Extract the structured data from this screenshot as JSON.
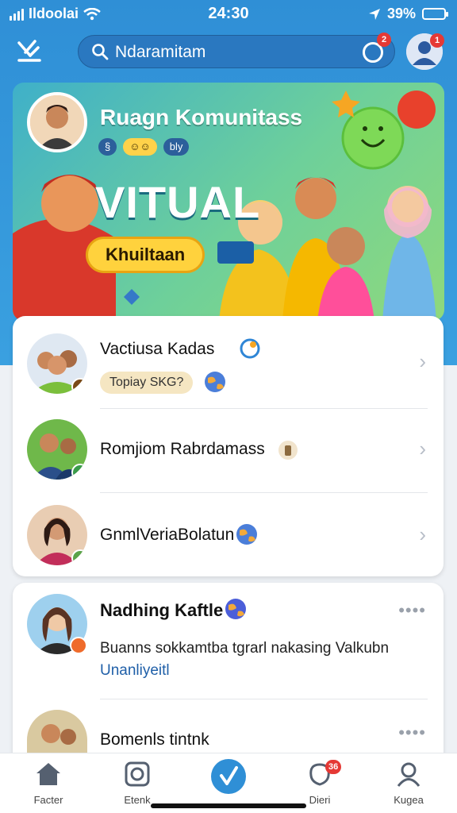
{
  "status_bar": {
    "carrier": "Ildoolai",
    "time": "24:30",
    "battery": "39%"
  },
  "search": {
    "value": "Ndaramitam",
    "notification_count": "2",
    "profile_badge": "1"
  },
  "hero": {
    "title": "Ruagn Komunitass",
    "chips": [
      "§",
      "☺☺",
      "bly"
    ],
    "banner_word": "VITUAL",
    "cta_label": "Khuiltaan"
  },
  "groups": [
    {
      "name": "Vactiusa Kadas",
      "tag": "Topiay SKG?"
    },
    {
      "name": "Romjiom Rabrdamass"
    },
    {
      "name": "GnmlVeriaBolatun"
    }
  ],
  "post": {
    "author": "Nadhing Kaftle",
    "text": "Buanns sokkamtba tgrarl nakasing Valkubn",
    "link": "Unanliyeitl",
    "more": "••••",
    "next_author": "Bomenls tintnk"
  },
  "nav": {
    "items": [
      {
        "label": "Facter",
        "icon": "home-icon"
      },
      {
        "label": "Etenk",
        "icon": "camera-icon"
      },
      {
        "label": "",
        "icon": "compose-icon"
      },
      {
        "label": "Dieri",
        "icon": "notifications-icon",
        "badge": "36"
      },
      {
        "label": "Kugea",
        "icon": "profile-icon"
      }
    ]
  },
  "colors": {
    "header_blue": "#2f8fd6",
    "accent_yellow": "#ffd23d",
    "badge_red": "#e53935",
    "link_blue": "#1f5fa8"
  }
}
